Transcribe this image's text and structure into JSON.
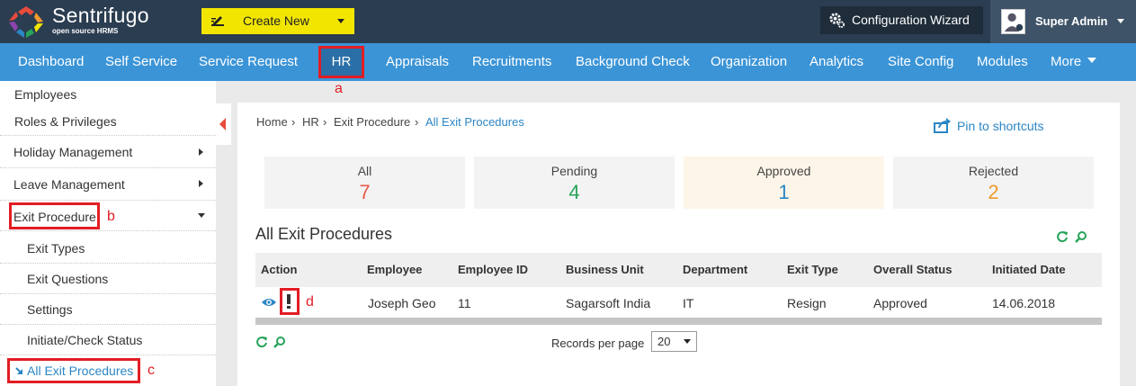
{
  "topbar": {
    "brand": "Sentrifugo",
    "brand_sub": "open source HRMS",
    "create_new": "Create New",
    "config_wizard": "Configuration Wizard",
    "user_name": "Super Admin"
  },
  "nav": {
    "items": [
      "Dashboard",
      "Self Service",
      "Service Request",
      "HR",
      "Appraisals",
      "Recruitments",
      "Background Check",
      "Organization",
      "Analytics",
      "Site Config",
      "Modules",
      "More"
    ]
  },
  "annotations": {
    "a": "a",
    "b": "b",
    "c": "c",
    "d": "d"
  },
  "sidebar": {
    "items": [
      "Employees",
      "Roles & Privileges",
      "Holiday Management",
      "Leave Management",
      "Exit Procedure",
      "Exit Types",
      "Exit Questions",
      "Settings",
      "Initiate/Check Status",
      "All Exit Procedures"
    ]
  },
  "breadcrumb": {
    "items": [
      "Home",
      "HR",
      "Exit Procedure",
      "All Exit Procedures"
    ],
    "separator": "›"
  },
  "pin_label": "Pin to shortcuts",
  "stats": [
    {
      "label": "All",
      "value": "7",
      "color": "#e8574b"
    },
    {
      "label": "Pending",
      "value": "4",
      "color": "#27a35a"
    },
    {
      "label": "Approved",
      "value": "1",
      "color": "#2b86c5"
    },
    {
      "label": "Rejected",
      "value": "2",
      "color": "#f29a2e"
    }
  ],
  "section_title": "All Exit Procedures",
  "table": {
    "headers": [
      "Action",
      "Employee",
      "Employee ID",
      "Business Unit",
      "Department",
      "Exit Type",
      "Overall Status",
      "Initiated Date"
    ],
    "rows": [
      [
        "",
        "Joseph Geo",
        "11",
        "Sagarsoft India",
        "IT",
        "Resign",
        "Approved",
        "14.06.2018"
      ]
    ]
  },
  "pager": {
    "records_label": "Records per page",
    "records_value": "20"
  },
  "colors": {
    "topbar": "#2b3d51",
    "nav": "#3b94d6",
    "accent": "#2b86c5",
    "annotation": "#e21d24",
    "create_btn": "#f2e600"
  }
}
